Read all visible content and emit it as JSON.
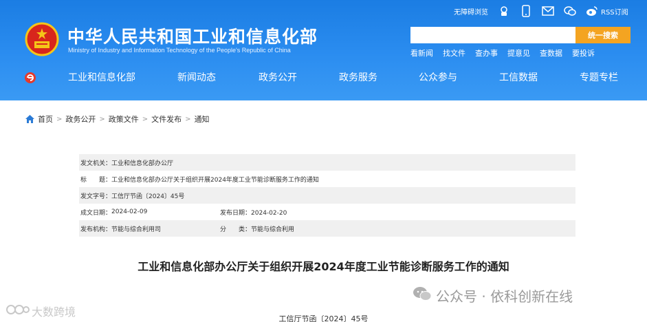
{
  "header": {
    "title": "中华人民共和国工业和信息化部",
    "subtitle": "Ministry of Industry and Information Technology of the People's Republic of China",
    "top_links": {
      "accessibility": "无障碍浏览",
      "rss": "RSS订阅"
    },
    "search": {
      "placeholder": "",
      "button": "统一搜索"
    },
    "quick_links": [
      "看新闻",
      "找文件",
      "查办事",
      "提意见",
      "查数据",
      "要投诉"
    ]
  },
  "nav": {
    "items": [
      "工业和信息化部",
      "新闻动态",
      "政务公开",
      "政务服务",
      "公众参与",
      "工信数据",
      "专题专栏"
    ]
  },
  "breadcrumb": [
    "首页",
    "政务公开",
    "政策文件",
    "文件发布",
    "通知"
  ],
  "info": {
    "issuer_label": "发文机关：",
    "issuer": "工业和信息化部办公厅",
    "title_label": "标　　题：",
    "title": "工业和信息化部办公厅关于组织开展2024年度工业节能诊断服务工作的通知",
    "doc_no_label": "发文字号：",
    "doc_no": "工信厅节函〔2024〕45号",
    "created_label": "成文日期：",
    "created": "2024-02-09",
    "published_label": "发布日期：",
    "published": "2024-02-20",
    "org_label": "发布机构：",
    "org": "节能与综合利用司",
    "category_label": "分　　类：",
    "category": "节能与综合利用"
  },
  "document": {
    "title": "工业和信息化部办公厅关于组织开展2024年度工业节能诊断服务工作的通知",
    "number": "工信厅节函〔2024〕45号"
  },
  "watermarks": {
    "left": "大数跨境",
    "right": "公众号 · 依科创新在线"
  },
  "colors": {
    "header_blue": "#2b8df0",
    "search_orange": "#f4a421"
  }
}
